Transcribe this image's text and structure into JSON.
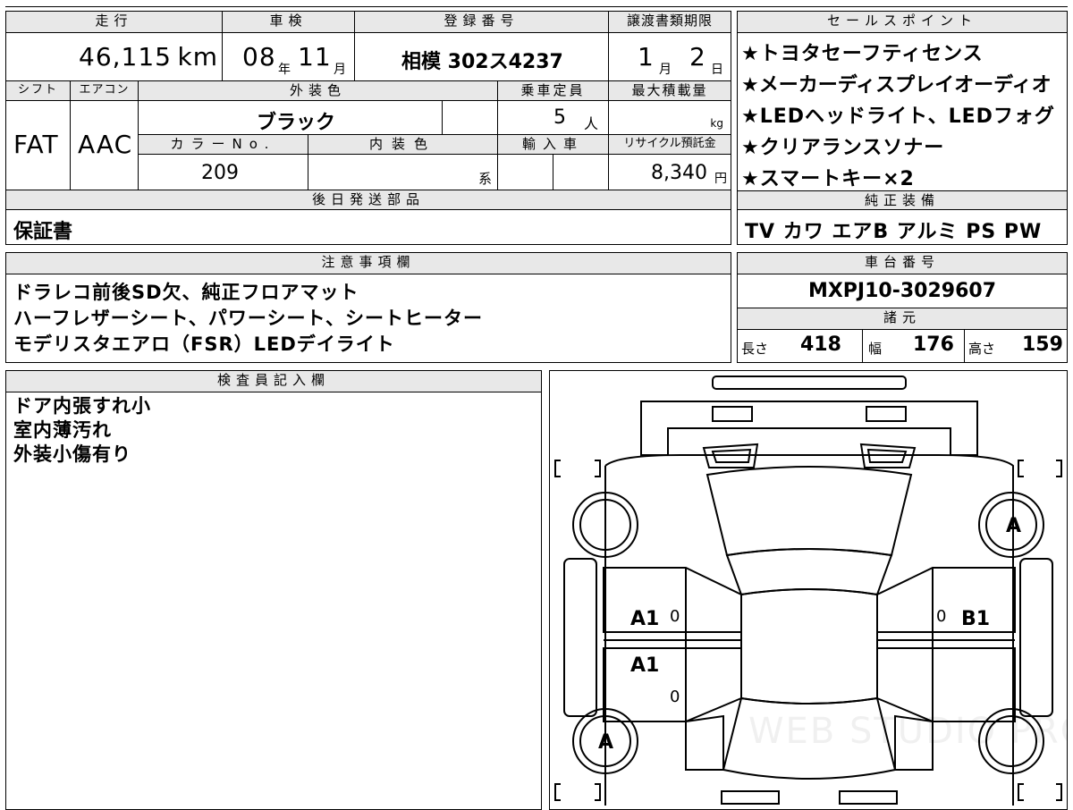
{
  "spec": {
    "mileage_label": "走行",
    "mileage_value": "46,115",
    "mileage_unit": "km",
    "inspection_label": "車検",
    "inspection_year": "08",
    "inspection_year_unit": "年",
    "inspection_month": "11",
    "inspection_month_unit": "月",
    "plate_label": "登録番号",
    "plate_value": "相模 302ス4237",
    "transfer_label": "譲渡書類期限",
    "transfer_month": "1",
    "transfer_month_unit": "月",
    "transfer_day": "2",
    "transfer_day_unit": "日",
    "shift_label": "シフト",
    "shift_value": "FAT",
    "ac_label": "エアコン",
    "ac_value": "AAC",
    "exterior_color_label": "外装色",
    "exterior_color_value": "ブラック",
    "capacity_label": "乗車定員",
    "capacity_value": "5",
    "capacity_unit": "人",
    "load_label": "最大積載量",
    "load_unit": "kg",
    "color_no_label": "カラーNo.",
    "color_no_value": "209",
    "interior_color_label": "内装色",
    "interior_color_suffix": "系",
    "import_label": "輸入車",
    "recycle_label": "リサイクル預託金",
    "recycle_value": "8,340",
    "recycle_unit": "円"
  },
  "later_parts": {
    "label": "後日発送部品",
    "value": "保証書"
  },
  "sales_points": {
    "label": "セールスポイント",
    "items": [
      "★トヨタセーフティセンス",
      "★メーカーディスプレイオーディオ",
      "★LEDヘッドライト、LEDフォグ",
      "★クリアランスソナー",
      "★スマートキー×2"
    ]
  },
  "equipment": {
    "label": "純正装備",
    "value": "TV カワ エアB アルミ PS PW"
  },
  "notes": {
    "label": "注意事項欄",
    "lines": [
      "ドラレコ前後SD欠、純正フロアマット",
      "ハーフレザーシート、パワーシート、シートヒーター",
      "モデリスタエアロ（FSR）LEDデイライト"
    ]
  },
  "chassis": {
    "label": "車台番号",
    "value": "MXPJ10-3029607"
  },
  "dims": {
    "label": "諸元",
    "length_label": "長さ",
    "length_value": "418",
    "width_label": "幅",
    "width_value": "176",
    "height_label": "高さ",
    "height_value": "159"
  },
  "inspector": {
    "label": "検査員記入欄",
    "lines": [
      "ドア内張すれ小",
      "室内薄汚れ",
      "外装小傷有り"
    ]
  },
  "diagram": {
    "marks": {
      "right_front_wheel": "A",
      "left_rear_wheel": "A",
      "left_front_door": "A1",
      "left_rear_door": "A1",
      "right_front_door": "B1",
      "zero_1": "0",
      "zero_2": "0",
      "zero_3": "0"
    },
    "watermark": "WEB STUDIO PRO"
  }
}
